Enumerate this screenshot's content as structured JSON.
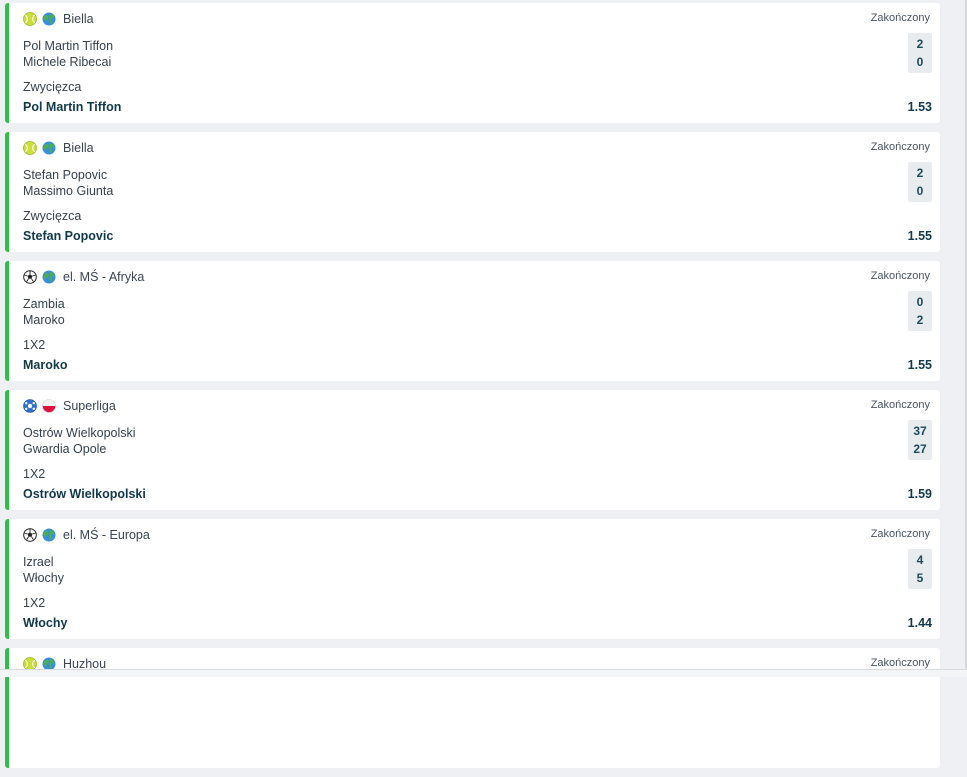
{
  "status_label": "Zakończony",
  "colors": {
    "accent": "#2fc04a",
    "pick_text": "#12394a",
    "score_bg": "#e8ecef"
  },
  "bets": [
    {
      "sport_icon": "tennis-ball-icon",
      "region_icon": "globe-icon",
      "league": "Biella",
      "status": "Zakończony",
      "home": "Pol Martin Tiffon",
      "away": "Michele Ribecai",
      "home_score": "2",
      "away_score": "0",
      "market": "Zwycięzca",
      "pick": "Pol Martin Tiffon",
      "odds": "1.53"
    },
    {
      "sport_icon": "tennis-ball-icon",
      "region_icon": "globe-icon",
      "league": "Biella",
      "status": "Zakończony",
      "home": "Stefan Popovic",
      "away": "Massimo Giunta",
      "home_score": "2",
      "away_score": "0",
      "market": "Zwycięzca",
      "pick": "Stefan Popovic",
      "odds": "1.55"
    },
    {
      "sport_icon": "soccer-ball-icon",
      "region_icon": "globe-icon",
      "league": "el. MŚ - Afryka",
      "status": "Zakończony",
      "home": "Zambia",
      "away": "Maroko",
      "home_score": "0",
      "away_score": "2",
      "market": "1X2",
      "pick": "Maroko",
      "odds": "1.55"
    },
    {
      "sport_icon": "handball-icon",
      "region_icon": "poland-flag-icon",
      "league": "Superliga",
      "status": "Zakończony",
      "home": "Ostrów Wielkopolski",
      "away": "Gwardia Opole",
      "home_score": "37",
      "away_score": "27",
      "market": "1X2",
      "pick": "Ostrów Wielkopolski",
      "odds": "1.59"
    },
    {
      "sport_icon": "soccer-ball-icon",
      "region_icon": "globe-icon",
      "league": "el. MŚ - Europa",
      "status": "Zakończony",
      "home": "Izrael",
      "away": "Włochy",
      "home_score": "4",
      "away_score": "5",
      "market": "1X2",
      "pick": "Włochy",
      "odds": "1.44"
    },
    {
      "sport_icon": "tennis-ball-icon",
      "region_icon": "globe-icon",
      "league": "Huzhou",
      "status": "Zakończony",
      "home": "",
      "away": "",
      "home_score": "",
      "away_score": "",
      "market": "",
      "pick": "",
      "odds": ""
    }
  ]
}
